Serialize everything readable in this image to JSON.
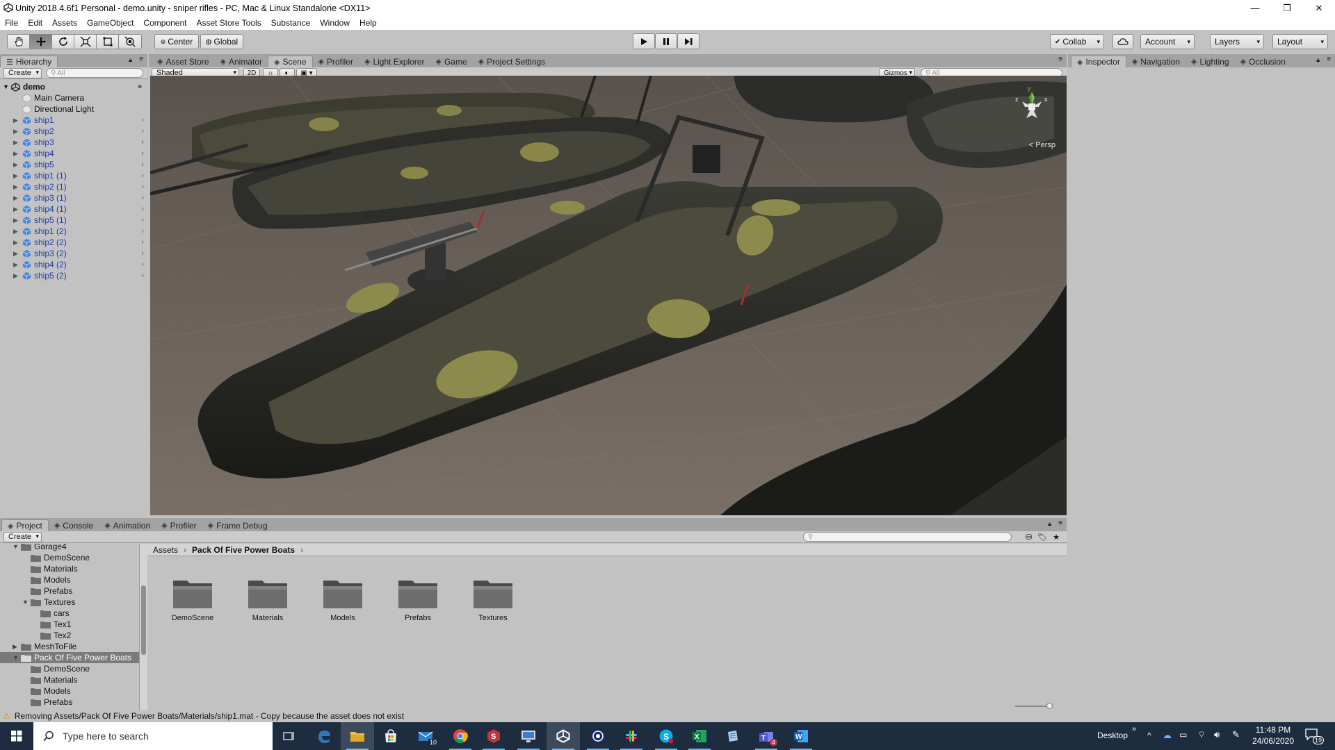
{
  "window": {
    "title": "Unity 2018.4.6f1 Personal - demo.unity - sniper rifles - PC, Mac & Linux Standalone <DX11>",
    "controls": [
      "—",
      "❐",
      "✕"
    ]
  },
  "menu": [
    "File",
    "Edit",
    "Assets",
    "GameObject",
    "Component",
    "Asset Store Tools",
    "Substance",
    "Window",
    "Help"
  ],
  "toolbar": {
    "pivot": "Center",
    "space": "Global",
    "collab": "Collab",
    "account": "Account",
    "layers": "Layers",
    "layout": "Layout"
  },
  "hierarchy": {
    "tab": "Hierarchy",
    "create": "Create",
    "search_placeholder": "All",
    "scene": "demo",
    "items": [
      {
        "label": "Main Camera",
        "prefab": false
      },
      {
        "label": "Directional Light",
        "prefab": false
      },
      {
        "label": "ship1",
        "prefab": true
      },
      {
        "label": "ship2",
        "prefab": true
      },
      {
        "label": "ship3",
        "prefab": true
      },
      {
        "label": "ship4",
        "prefab": true
      },
      {
        "label": "ship5",
        "prefab": true
      },
      {
        "label": "ship1 (1)",
        "prefab": true
      },
      {
        "label": "ship2 (1)",
        "prefab": true
      },
      {
        "label": "ship3 (1)",
        "prefab": true
      },
      {
        "label": "ship4 (1)",
        "prefab": true
      },
      {
        "label": "ship5 (1)",
        "prefab": true
      },
      {
        "label": "ship1 (2)",
        "prefab": true
      },
      {
        "label": "ship2 (2)",
        "prefab": true
      },
      {
        "label": "ship3 (2)",
        "prefab": true
      },
      {
        "label": "ship4 (2)",
        "prefab": true
      },
      {
        "label": "ship5 (2)",
        "prefab": true
      }
    ]
  },
  "center_tabs": [
    {
      "label": "Asset Store",
      "icon": "store-icon"
    },
    {
      "label": "Animator",
      "icon": "animator-icon"
    },
    {
      "label": "Scene",
      "icon": "scene-icon",
      "active": true
    },
    {
      "label": "Profiler",
      "icon": "profiler-icon"
    },
    {
      "label": "Light Explorer",
      "icon": "light-icon"
    },
    {
      "label": "Game",
      "icon": "game-icon"
    },
    {
      "label": "Project Settings",
      "icon": "gear-icon"
    }
  ],
  "scene_bar": {
    "shading": "Shaded",
    "mode_2d": "2D",
    "gizmos": "Gizmos",
    "search_placeholder": "All",
    "persp": "< Persp"
  },
  "right_tabs": [
    {
      "label": "Inspector",
      "active": true
    },
    {
      "label": "Navigation"
    },
    {
      "label": "Lighting"
    },
    {
      "label": "Occlusion"
    }
  ],
  "bottom_tabs": [
    {
      "label": "Project",
      "active": true
    },
    {
      "label": "Console"
    },
    {
      "label": "Animation"
    },
    {
      "label": "Profiler"
    },
    {
      "label": "Frame Debug"
    }
  ],
  "project": {
    "create": "Create",
    "tree": [
      {
        "label": "Garage4",
        "indent": 0,
        "expanded": true
      },
      {
        "label": "DemoScene",
        "indent": 1
      },
      {
        "label": "Materials",
        "indent": 1
      },
      {
        "label": "Models",
        "indent": 1
      },
      {
        "label": "Prefabs",
        "indent": 1
      },
      {
        "label": "Textures",
        "indent": 1,
        "expanded": true
      },
      {
        "label": "cars",
        "indent": 2
      },
      {
        "label": "Tex1",
        "indent": 2
      },
      {
        "label": "Tex2",
        "indent": 2
      },
      {
        "label": "MeshToFile",
        "indent": 0,
        "collapsed": true
      },
      {
        "label": "Pack Of Five Power Boats",
        "indent": 0,
        "expanded": true,
        "selected": true
      },
      {
        "label": "DemoScene",
        "indent": 1
      },
      {
        "label": "Materials",
        "indent": 1
      },
      {
        "label": "Models",
        "indent": 1
      },
      {
        "label": "Prefabs",
        "indent": 1
      }
    ],
    "breadcrumb": [
      "Assets",
      "Pack Of Five Power Boats"
    ],
    "folders": [
      "DemoScene",
      "Materials",
      "Models",
      "Prefabs",
      "Textures"
    ]
  },
  "status": "Removing Assets/Pack Of Five Power Boats/Materials/ship1.mat - Copy because the asset does not exist",
  "taskbar": {
    "search_placeholder": "Type here to search",
    "desktop": "Desktop",
    "time": "11:48 PM",
    "date": "24/06/2020",
    "notification_count": "19",
    "mail_badge": "10",
    "teams_badge": "4"
  },
  "colors": {
    "editor_bg": "#c2c2c2",
    "prefab_blue": "#1d3ea8",
    "taskbar": "#1d2c3e",
    "selection": "#7a7a7a"
  }
}
